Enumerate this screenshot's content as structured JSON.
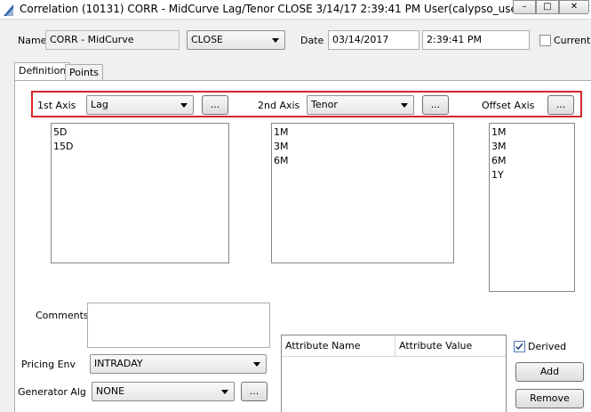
{
  "window": {
    "title": "Correlation (10131) CORR - MidCurve Lag/Tenor CLOSE 3/14/17 2:39:41 PM User(calypso_user)",
    "min_symbol": "–",
    "max_symbol": "□",
    "close_symbol": "✕"
  },
  "header": {
    "name_label": "Name",
    "name_value": "CORR - MidCurve",
    "quote_value": "CLOSE",
    "date_label": "Date",
    "date_value": "03/14/2017",
    "time_value": "2:39:41 PM",
    "current_label": "Current",
    "current_checked": false
  },
  "tabs": [
    {
      "label": "Definition",
      "active": true
    },
    {
      "label": "Points",
      "active": false
    }
  ],
  "axes": {
    "first": {
      "label": "1st Axis",
      "value": "Lag",
      "items": [
        "5D",
        "15D"
      ]
    },
    "second": {
      "label": "2nd Axis",
      "value": "Tenor",
      "items": [
        "1M",
        "3M",
        "6M"
      ]
    },
    "offset": {
      "label": "Offset Axis",
      "items": [
        "1M",
        "3M",
        "6M",
        "1Y"
      ]
    },
    "ellipsis": "..."
  },
  "form": {
    "comments_label": "Comments",
    "comments_value": "",
    "pricing_env_label": "Pricing Env",
    "pricing_env_value": "INTRADAY",
    "generator_label": "Generator Alg",
    "generator_value": "NONE"
  },
  "attributes": {
    "columns": [
      "Attribute Name",
      "Attribute Value"
    ]
  },
  "actions": {
    "derived_label": "Derived",
    "derived_checked": true,
    "add_label": "Add",
    "remove_label": "Remove"
  },
  "colors": {
    "highlight_border": "#d6262b",
    "title_icon": "#2c5fa8"
  }
}
